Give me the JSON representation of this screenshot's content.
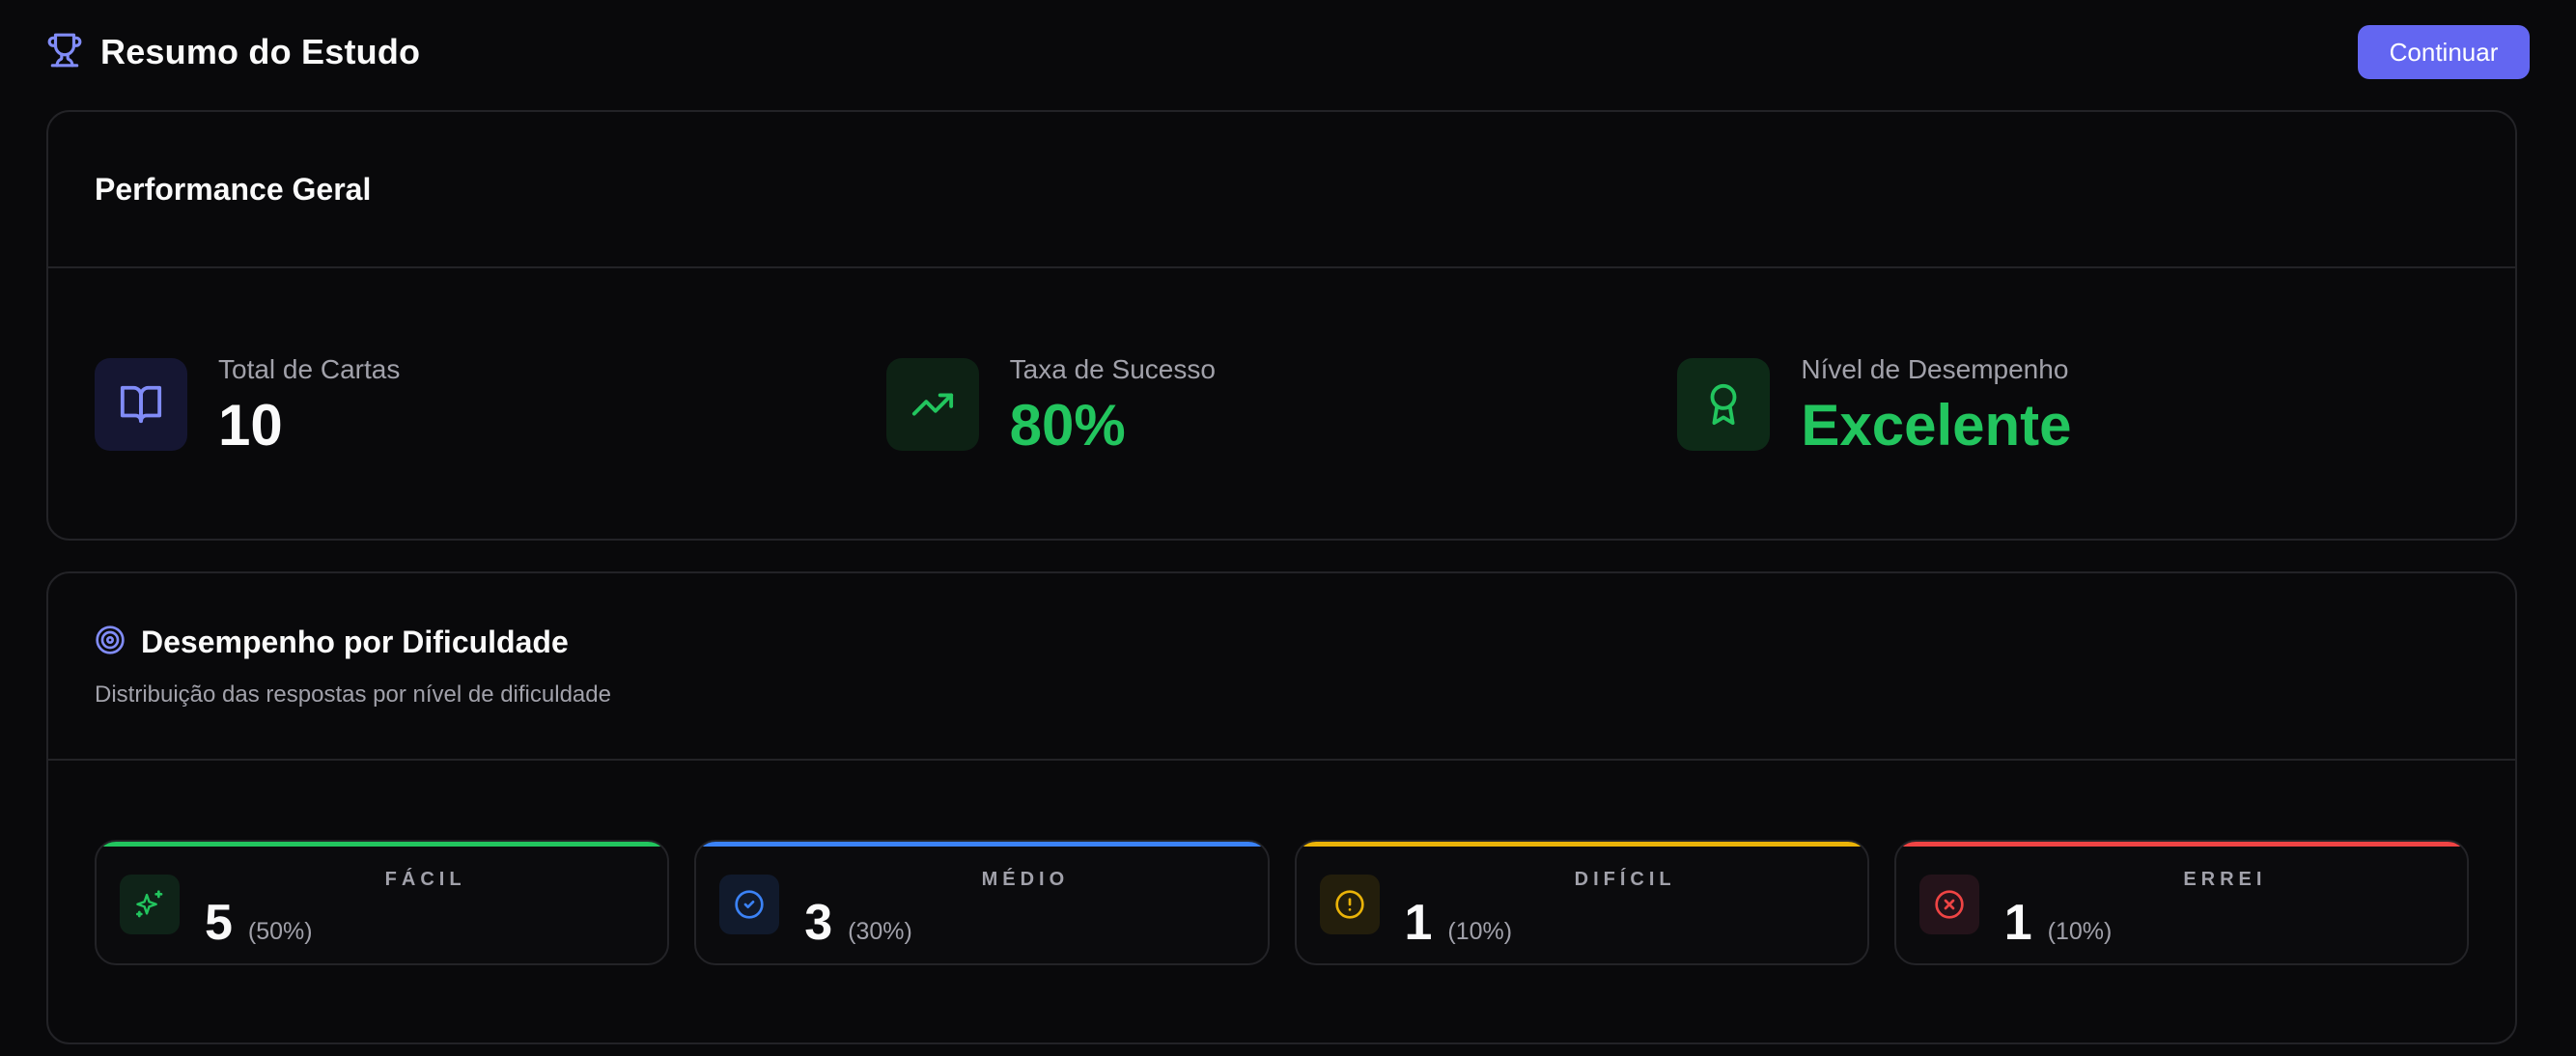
{
  "header": {
    "title": "Resumo do Estudo",
    "continue_label": "Continuar",
    "icon": "trophy-icon"
  },
  "performance": {
    "title": "Performance Geral",
    "stats": [
      {
        "label": "Total de Cartas",
        "value": "10",
        "icon": "book-open-icon",
        "color": "#818cf8"
      },
      {
        "label": "Taxa de Sucesso",
        "value": "80%",
        "icon": "trending-up-icon",
        "color": "#22c55e"
      },
      {
        "label": "Nível de Desempenho",
        "value": "Excelente",
        "icon": "award-icon",
        "color": "#22c55e"
      }
    ]
  },
  "difficulty": {
    "title": "Desempenho por Dificuldade",
    "subtitle": "Distribuição das respostas por nível de dificuldade",
    "icon": "target-icon",
    "items": [
      {
        "name": "FÁCIL",
        "count": "5",
        "pct": "(50%)",
        "icon": "sparkles-icon",
        "color": "#22c55e"
      },
      {
        "name": "MÉDIO",
        "count": "3",
        "pct": "(30%)",
        "icon": "check-circle-icon",
        "color": "#3b82f6"
      },
      {
        "name": "DIFÍCIL",
        "count": "1",
        "pct": "(10%)",
        "icon": "alert-circle-icon",
        "color": "#eab308"
      },
      {
        "name": "ERREI",
        "count": "1",
        "pct": "(10%)",
        "icon": "x-circle-icon",
        "color": "#ef4444"
      }
    ]
  },
  "colors": {
    "background": "#09090b",
    "accent": "#6366f1",
    "success": "#22c55e",
    "border": "#232327"
  }
}
